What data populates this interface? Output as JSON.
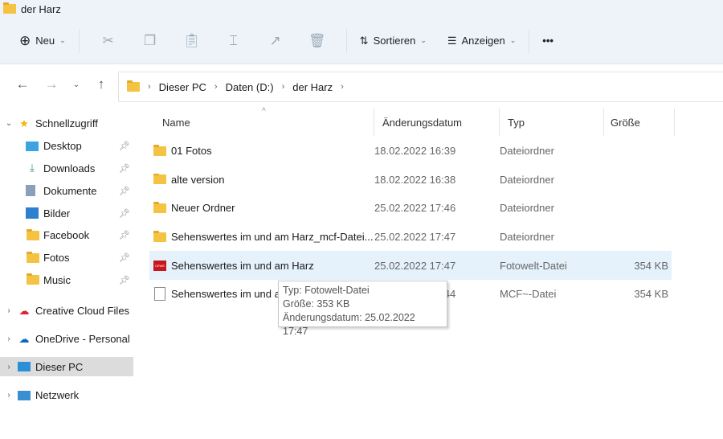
{
  "window": {
    "title": "der Harz"
  },
  "toolbar": {
    "new_label": "Neu",
    "sort_label": "Sortieren",
    "view_label": "Anzeigen",
    "more": "•••",
    "icons": [
      "cut-icon",
      "copy-icon",
      "paste-icon",
      "rename-icon",
      "share-icon",
      "delete-icon"
    ]
  },
  "address": {
    "crumbs": [
      "Dieser PC",
      "Daten (D:)",
      "der Harz"
    ]
  },
  "sidebar": {
    "quick": "Schnellzugriff",
    "pinned": [
      {
        "label": "Desktop",
        "icon": "desktop-icon"
      },
      {
        "label": "Downloads",
        "icon": "download-icon"
      },
      {
        "label": "Dokumente",
        "icon": "document-icon"
      },
      {
        "label": "Bilder",
        "icon": "pictures-icon"
      },
      {
        "label": "Facebook",
        "icon": "folder-icon"
      },
      {
        "label": "Fotos",
        "icon": "folder-icon"
      },
      {
        "label": "Music",
        "icon": "folder-icon"
      }
    ],
    "roots": [
      "Creative Cloud Files",
      "OneDrive - Personal",
      "Dieser PC",
      "Netzwerk"
    ]
  },
  "columns": [
    "Name",
    "Änderungsdatum",
    "Typ",
    "Größe"
  ],
  "files": [
    {
      "name": "01 Fotos",
      "date": "18.02.2022 16:39",
      "type": "Dateiordner",
      "size": "",
      "kind": "folder"
    },
    {
      "name": "alte version",
      "date": "18.02.2022 16:38",
      "type": "Dateiordner",
      "size": "",
      "kind": "folder"
    },
    {
      "name": "Neuer Ordner",
      "date": "25.02.2022 17:46",
      "type": "Dateiordner",
      "size": "",
      "kind": "folder"
    },
    {
      "name": "Sehenswertes im und am Harz_mcf-Datei...",
      "date": "25.02.2022 17:47",
      "type": "Dateiordner",
      "size": "",
      "kind": "folder"
    },
    {
      "name": "Sehenswertes im und am Harz",
      "date": "25.02.2022 17:47",
      "type": "Fotowelt-Datei",
      "size": "354 KB",
      "kind": "mcf"
    },
    {
      "name": "Sehenswertes im und am Harz",
      "date": "25.02.2022 17:44",
      "type": "MCF~-Datei",
      "size": "354 KB",
      "kind": "file"
    }
  ],
  "tooltip": {
    "type": "Typ: Fotowelt-Datei",
    "size": "Größe: 353 KB",
    "date": "Änderungsdatum: 25.02.2022 17:47"
  }
}
